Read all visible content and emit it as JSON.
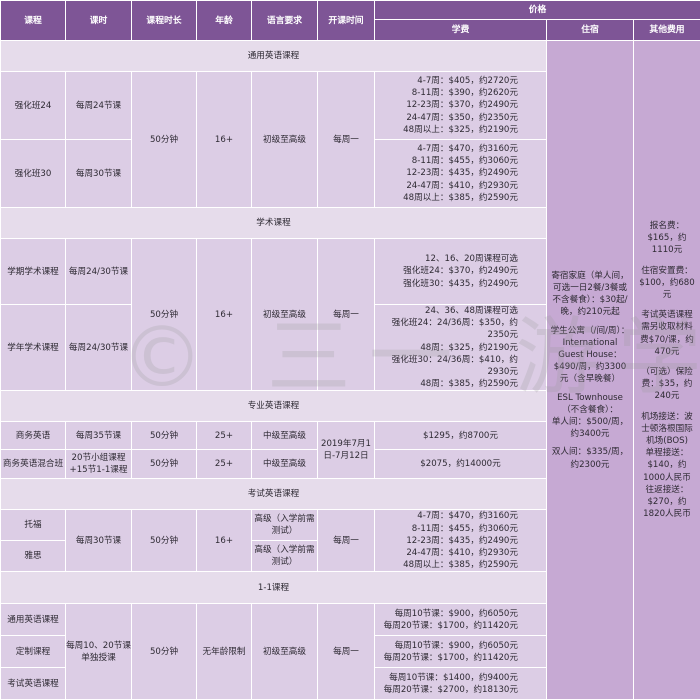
{
  "header": {
    "course": "课程",
    "hours": "课时",
    "duration": "课程时长",
    "age": "年龄",
    "language": "语言要求",
    "start": "开课时间",
    "price": "价格",
    "tuition": "学费",
    "accommodation": "住宿",
    "other": "其他费用"
  },
  "sections": {
    "general": "通用英语课程",
    "academic": "学术课程",
    "professional": "专业英语课程",
    "exam": "考试英语课程",
    "one_on_one": "1-1课程"
  },
  "general": {
    "duration": "50分钟",
    "age": "16+",
    "language": "初级至高级",
    "start": "每周一",
    "rows": [
      {
        "course": "强化班24",
        "hours": "每周24节课",
        "fees": [
          "4-7周：$405，约2720元",
          "8-11周：$390，约2620元",
          "12-23周：$370，约2490元",
          "24-47周：$350，约2350元",
          "48周以上：$325，约2190元"
        ]
      },
      {
        "course": "强化班30",
        "hours": "每周30节课",
        "fees": [
          "4-7周：$470，约3160元",
          "8-11周：$455，约3060元",
          "12-23周：$435，约2490元",
          "24-47周：$410，约2930元",
          "48周以上：$385，约2590元"
        ]
      }
    ]
  },
  "academic": {
    "duration": "50分钟",
    "age": "16+",
    "language": "初级至高级",
    "start": "每周一",
    "rows": [
      {
        "course": "学期学术课程",
        "hours": "每周24/30节课",
        "fees": [
          "12、16、20周课程可选",
          "强化班24：$370，约2490元",
          "强化班30：$435，约2490元"
        ]
      },
      {
        "course": "学年学术课程",
        "hours": "每周24/30节课",
        "fees": [
          "24、36、48周课程可选",
          "强化班24：24/36周：$350，约2350元",
          "48周：$325，约2190元",
          "强化班30：24/36周：$410，约2930元",
          "48周：$385，约2590元"
        ]
      }
    ]
  },
  "professional": {
    "start": "2019年7月1日-7月12日",
    "rows": [
      {
        "course": "商务英语",
        "hours": "每周35节课",
        "duration": "50分钟",
        "age": "25+",
        "language": "中级至高级",
        "fee": "$1295，约8700元"
      },
      {
        "course": "商务英语混合班",
        "hours": "20节小组课程+15节1-1课程",
        "duration": "50分钟",
        "age": "25+",
        "language": "中级至高级",
        "fee": "$2075，约14000元"
      }
    ]
  },
  "exam": {
    "hours": "每周30节课",
    "duration": "50分钟",
    "age": "16+",
    "start": "每周一",
    "rows": [
      {
        "course": "托福",
        "language": "高级（入学前需测试）"
      },
      {
        "course": "雅思",
        "language": "高级（入学前需测试）"
      }
    ],
    "fees": [
      "4-7周：$470，约3160元",
      "8-11周：$455，约3060元",
      "12-23周：$435，约2490元",
      "24-47周：$410，约2930元",
      "48周以上：$385，约2590元"
    ]
  },
  "one_on_one": {
    "hours": "每周10、20节课单独授课",
    "duration": "50分钟",
    "age": "无年龄限制",
    "language": "初级至高级",
    "start": "每周一",
    "rows": [
      {
        "course": "通用英语课程",
        "fees": [
          "每周10节课：$900，约6050元",
          "每周20节课：$1700，约11420元"
        ]
      },
      {
        "course": "定制课程",
        "fees": [
          "每周10节课：$900，约6050元",
          "每周20节课：$1700，约11420元"
        ]
      },
      {
        "course": "考试英语课程",
        "fees": [
          "每周10节课：$1400，约9400元",
          "每周20节课：$2700，约18130元"
        ]
      }
    ]
  },
  "accommodation": [
    "寄宿家庭（单人间，可选一日2餐/3餐或不含餐食）：$30起/晚，约210元起",
    "学生公寓（/间/周）：International Guest House：$490/周，约3300元（含早晚餐）",
    "ESL Townhouse（不含餐食）：",
    "单人间：$500/周，约3400元",
    "双人间：$335/周，约2300元"
  ],
  "other_fees": [
    "报名费：$165，约1110元",
    "住宿安置费：$100，约680元",
    "考试英语课程需另收取材料费$70/课，约470元",
    "（可选）保险费：$35，约240元",
    "机场接送：波士顿洛根国际机场(BOS)",
    "单程接送：$140，约1000人民币",
    "往返接送：$270，约1820人民币"
  ],
  "watermark": "© 三一 游学"
}
